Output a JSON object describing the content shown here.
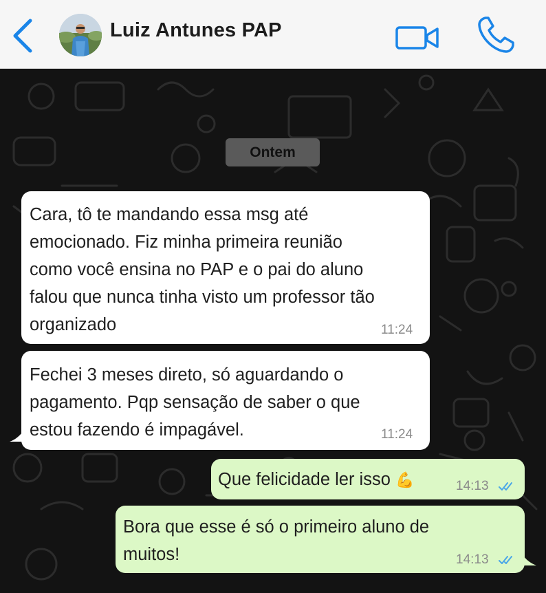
{
  "header": {
    "contact_name": "Luiz Antunes PAP",
    "back_icon": "chevron-left-icon",
    "video_icon": "video-camera-icon",
    "call_icon": "phone-icon",
    "accent_color": "#1a85e8"
  },
  "chat": {
    "date_label": "Ontem",
    "messages": [
      {
        "direction": "incoming",
        "lines": [
          "Cara, tô te mandando essa msg até",
          "emocionado. Fiz minha primeira reunião",
          "como você ensina no PAP e o pai do aluno",
          "falou que nunca tinha visto um professor tão",
          "organizado"
        ],
        "time": "11:24"
      },
      {
        "direction": "incoming",
        "lines": [
          "Fechei 3 meses direto, só aguardando o",
          "pagamento. Pqp sensação de saber o que",
          "estou fazendo é impagável."
        ],
        "time": "11:24"
      },
      {
        "direction": "outgoing",
        "text": "Que felicidade ler isso",
        "emoji": "💪",
        "time": "14:13",
        "status": "read"
      },
      {
        "direction": "outgoing",
        "lines": [
          "Bora que esse é só o primeiro aluno de",
          "muitos!"
        ],
        "time": "14:13",
        "status": "read"
      }
    ],
    "colors": {
      "incoming_bubble": "#ffffff",
      "outgoing_bubble": "#dcf8c6",
      "read_ticks": "#4aa6e8",
      "wallpaper": "#131313"
    }
  }
}
